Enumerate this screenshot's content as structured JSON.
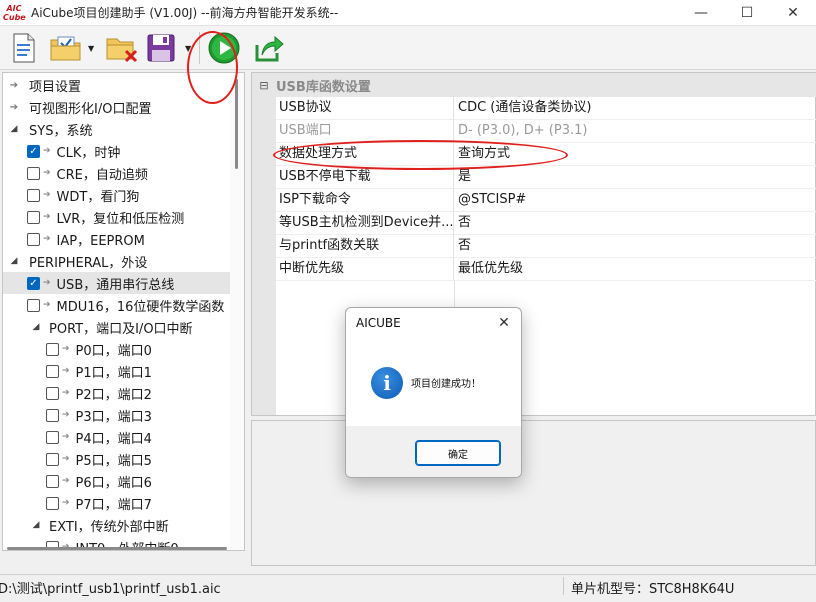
{
  "window": {
    "logo_text": "AIC Cube",
    "title": "AiCube项目创建助手 (V1.00J) --前海方舟智能开发系统--",
    "minimize": "—",
    "maximize": "☐",
    "close": "✕"
  },
  "toolbar": {
    "buttons": [
      "new-project",
      "open-settings",
      "delete-project",
      "save-project",
      "run",
      "export"
    ]
  },
  "tree": {
    "items": [
      {
        "label": "项目设置",
        "kind": "arrow"
      },
      {
        "label": "可视图形化I/O口配置",
        "kind": "arrow"
      },
      {
        "label": "SYS，系统",
        "kind": "group"
      },
      {
        "label": "CLK，时钟",
        "kind": "check",
        "checked": true
      },
      {
        "label": "CRE，自动追频",
        "kind": "check",
        "checked": false
      },
      {
        "label": "WDT，看门狗",
        "kind": "check",
        "checked": false
      },
      {
        "label": "LVR，复位和低压检测",
        "kind": "check",
        "checked": false
      },
      {
        "label": "IAP，EEPROM",
        "kind": "check",
        "checked": false
      },
      {
        "label": "PERIPHERAL，外设",
        "kind": "group"
      },
      {
        "label": "USB，通用串行总线",
        "kind": "check",
        "checked": true,
        "selected": true
      },
      {
        "label": "MDU16，16位硬件数学函数",
        "kind": "check",
        "checked": false
      },
      {
        "label": "PORT，端口及I/O口中断",
        "kind": "subgroup"
      },
      {
        "label": "P0口，端口0",
        "kind": "subcheck",
        "checked": false
      },
      {
        "label": "P1口，端口1",
        "kind": "subcheck",
        "checked": false
      },
      {
        "label": "P2口，端口2",
        "kind": "subcheck",
        "checked": false
      },
      {
        "label": "P3口，端口3",
        "kind": "subcheck",
        "checked": false
      },
      {
        "label": "P4口，端口4",
        "kind": "subcheck",
        "checked": false
      },
      {
        "label": "P5口，端口5",
        "kind": "subcheck",
        "checked": false
      },
      {
        "label": "P6口，端口6",
        "kind": "subcheck",
        "checked": false
      },
      {
        "label": "P7口，端口7",
        "kind": "subcheck",
        "checked": false
      },
      {
        "label": "EXTI，传统外部中断",
        "kind": "subgroup"
      },
      {
        "label": "INT0，外部中断0",
        "kind": "subcheck",
        "checked": false
      }
    ]
  },
  "properties": {
    "section_title": "USB库函数设置",
    "rows": [
      {
        "name": "USB协议",
        "value": "CDC (通信设备类协议)",
        "disabled": false
      },
      {
        "name": "USB端口",
        "value": "D- (P3.0), D+ (P3.1)",
        "disabled": true
      },
      {
        "name": "数据处理方式",
        "value": "查询方式",
        "disabled": false
      },
      {
        "name": "USB不停电下载",
        "value": "是",
        "disabled": false
      },
      {
        "name": "ISP下载命令",
        "value": "@STCISP#",
        "disabled": false
      },
      {
        "name": "等USB主机检测到Device并...",
        "value": "否",
        "disabled": false
      },
      {
        "name": "与printf函数关联",
        "value": "否",
        "disabled": false
      },
      {
        "name": "中断优先级",
        "value": "最低优先级",
        "disabled": false
      }
    ]
  },
  "status": {
    "path": "D:\\测试\\printf_usb1\\printf_usb1.aic",
    "chip": "单片机型号：STC8H8K64U"
  },
  "dialog": {
    "title": "AICUBE",
    "message": "项目创建成功！",
    "ok_label": "确定",
    "close": "✕",
    "info_glyph": "i"
  },
  "colors": {
    "accent": "#0067c0",
    "annotation": "#e0201c",
    "run_green": "#1e9a2e"
  }
}
